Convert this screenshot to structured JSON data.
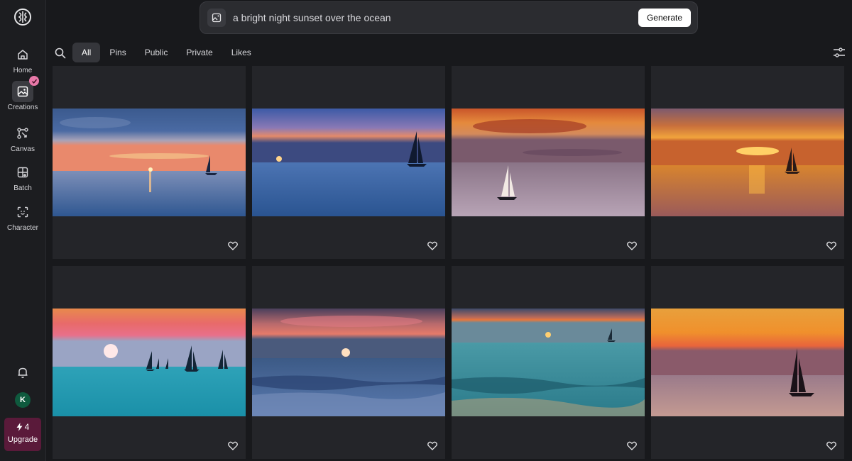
{
  "sidebar": {
    "logo_icon": "brain-logo-icon",
    "items": [
      {
        "label": "Home",
        "icon": "home-icon"
      },
      {
        "label": "Creations",
        "icon": "image-gallery-icon",
        "active": true
      },
      {
        "label": "Canvas",
        "icon": "canvas-nodes-icon"
      },
      {
        "label": "Batch",
        "icon": "batch-grid-icon"
      },
      {
        "label": "Character",
        "icon": "face-scan-icon"
      }
    ],
    "avatar_initial": "K",
    "upgrade": {
      "credits": "4",
      "label": "Upgrade"
    }
  },
  "prompt": {
    "text": "a bright night sunset over the ocean",
    "generate_label": "Generate"
  },
  "filters": {
    "tabs": [
      "All",
      "Pins",
      "Public",
      "Private",
      "Likes"
    ],
    "active": "All"
  },
  "colors": {
    "background": "#18191c",
    "sidebar": "#1c1d20",
    "card": "#242529",
    "upgrade": "#5a1a3a",
    "badge": "#e879a8"
  },
  "gallery": [
    {
      "scene": "blue sunset with distant sailboat"
    },
    {
      "scene": "purple sky setting sun with sailboat"
    },
    {
      "scene": "orange clouds with sailboat on calm sea"
    },
    {
      "scene": "golden sunset reflection with sailboat"
    },
    {
      "scene": "pink sun over teal sea with fleet of sailboats"
    },
    {
      "scene": "red sun setting over waves"
    },
    {
      "scene": "sunset over teal waves with small sail"
    },
    {
      "scene": "orange sky with sailboat on pink water"
    }
  ]
}
